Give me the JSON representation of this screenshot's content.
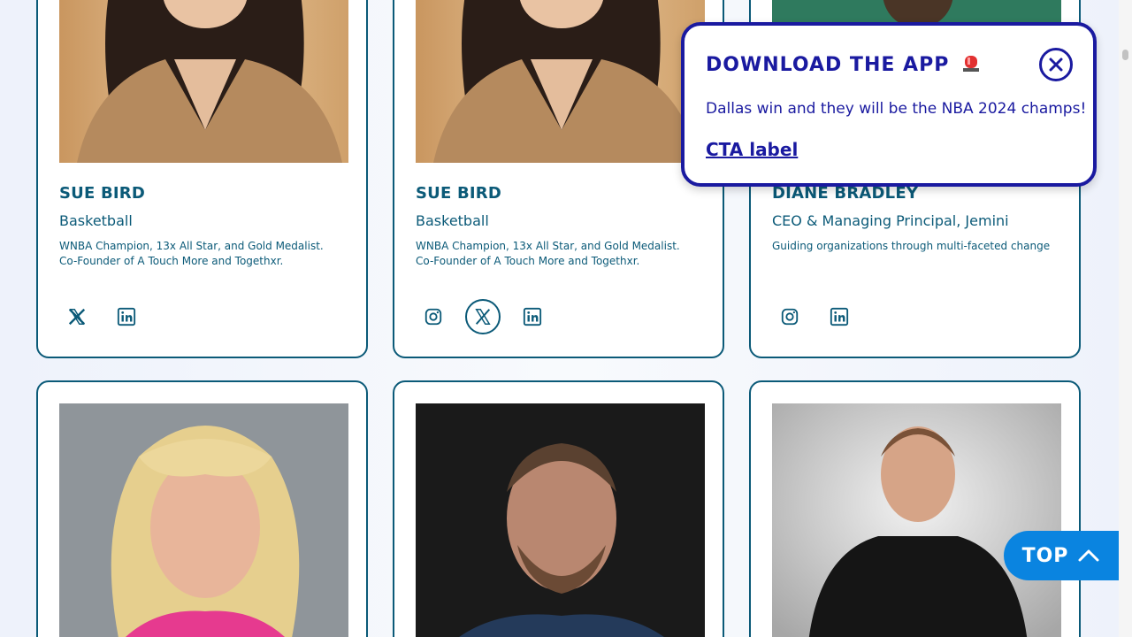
{
  "cards_row1": [
    {
      "name": "SUE BIRD",
      "role": "Basketball",
      "bio": "WNBA Champion, 13x All Star, and Gold Medalist. Co-Founder of A Touch More and Togethxr.",
      "socials": [
        "x-icon",
        "linkedin-icon"
      ]
    },
    {
      "name": "SUE BIRD",
      "role": "Basketball",
      "bio": "WNBA Champion, 13x All Star, and Gold Medalist. Co-Founder of A Touch More and Togethxr.",
      "socials": [
        "instagram-icon",
        "x-icon",
        "linkedin-icon"
      ]
    },
    {
      "name": "DIANE BRADLEY",
      "role": "CEO & Managing Principal, Jemini",
      "bio": "Guiding organizations through multi-faceted change",
      "socials": [
        "instagram-icon",
        "linkedin-icon"
      ]
    }
  ],
  "popup": {
    "title": "DOWNLOAD THE APP",
    "title_icon": "siren-icon",
    "message": "Dallas win and they will be the NBA 2024 champs!",
    "cta": "CTA label",
    "close_icon": "close-icon"
  },
  "top_button": {
    "label": "TOP",
    "icon": "chevron-up-icon"
  },
  "colors": {
    "card_border": "#0b5a78",
    "text": "#0b5a78",
    "popup_accent": "#1a1aa0",
    "top_button_bg": "#0a84e0"
  }
}
